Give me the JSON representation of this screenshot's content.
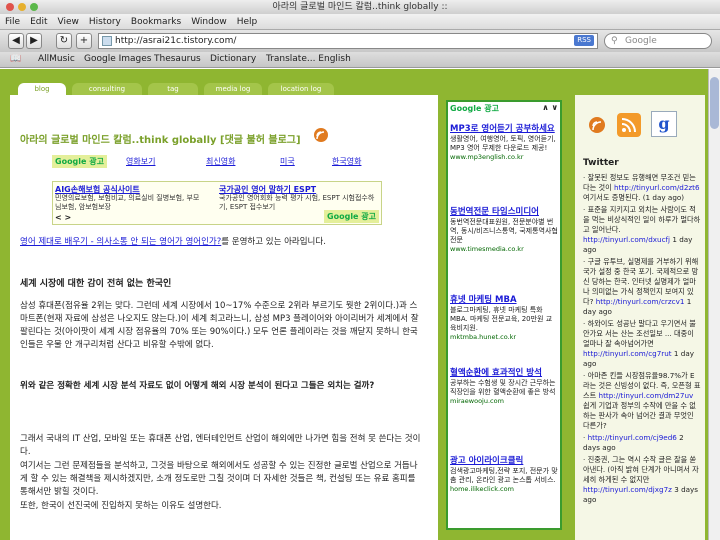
{
  "window": {
    "title": "아라의 글로벌 마인드 칼럼..think globally ::"
  },
  "menu": [
    "File",
    "Edit",
    "View",
    "History",
    "Bookmarks",
    "Window",
    "Help"
  ],
  "toolbar": {
    "url": "http://asrai21c.tistory.com/",
    "rss": "RSS",
    "search_placeholder": "Google"
  },
  "bookmarks": [
    "AllMusic",
    "Google Images",
    "Thesaurus",
    "Dictionary",
    "Translate... English"
  ],
  "tabs": [
    "blog",
    "consulting",
    "tag",
    "media log",
    "location log"
  ],
  "blog": {
    "title": "아라의 글로벌 마인드 칼럼..think globally [댓글 불허 블로그]"
  },
  "adlinks": {
    "brand": "Google 광고",
    "items": [
      "영화보기",
      "최신영화",
      "미국",
      "한국영화"
    ]
  },
  "ad_banner": {
    "left_title": "AIG손해보험 공식사이트",
    "left_desc": "민영의료보험, 보험비교, 의료실비 질병보험, 부모님보험, 암보험보장",
    "right_title": "국가공인 영어 말하기 ESPT",
    "right_desc": "국가공인 영어회화 능력 평가 시험, ESPT 시험접수하기, ESPT 접수보기",
    "nav": "< >",
    "brand": "Google 광고"
  },
  "post": {
    "intro_link": "영어 제대로 배우기 - 의사소통 안 되는 영어가 영어인가?",
    "intro_rest": "를 운영하고 있는 아라입니다.",
    "heading1": "세계 시장에 대한 감이 전혀 없는 한국인",
    "para1": "삼성 휴대폰(점유율 2위는 맞다. 그런데 세계 시장에서 10~17% 수준으로 2위라 부르기도 뭣한 2위이다.)과 스마트폰(현재 자료에 삼성은 나오지도 않는다.)이 세계 최고라느니, 삼성 MP3 플레이어와 아이리버가 세계에서 잘 팔린다는 것(아이팟이 세계 시장 점유율의 70% 또는 90%이다.) 모두 언론 플레이라는 것을 깨닫지 못하니 한국인들은 우물 안 개구리처럼 산다고 비유할 수밖에 없다.",
    "heading2": "위와 같은 정확한 세계 시장 분석 자료도 없이 어떻게 해외 시장 분석이 된다고 그들은 외치는 걸까?",
    "para2": "그래서 국내의 IT 산업, 모바일 또는 휴대폰 산업, 엔터테인먼트 산업이 해외에만 나가면 힘을 전혀 못 쓴다는 것이다.",
    "para3": "여기서는 그런 문제점들을 분석하고, 그것을 바탕으로 해외에서도 성공할 수 있는 진정한 글로벌 산업으로 거듭나게 할 수 있는 해결책을 제시하겠지만, 소개 정도로만 그칠 것이며 더 자세한 것들은 책, 컨설팅 또는 유료 홈피를 통해서만 밝힐 것이다.",
    "para4": "또한, 한국이 선진국에 진입하지 못하는 이유도 설명한다."
  },
  "ad_column": {
    "brand": "Google 광고",
    "nav": "∧ ∨",
    "ads": [
      {
        "title": "MP3로 영어듣기 공부하세요",
        "desc": "생활영어, 여행영어, 토픽, 영어듣기, MP3 영어 무제한 다운로드 제공!",
        "url": "www.mp3english.co.kr"
      },
      {
        "title": "동번역전문 타임스미디어",
        "desc": "동번역전문대표원원, 전문분야별 번역, 동시/비즈니스통역, 국제통역사협전문",
        "url": "www.timesmedia.co.kr"
      },
      {
        "title": "휴넷 마케팅 MBA",
        "desc": "블로그마케팅, 휴넷 마케팅 특화 MBA. 마케팅 전문교육, 20만원 교육비지원.",
        "url": "mktmba.hunet.co.kr"
      },
      {
        "title": "혈액순환에 효과적인 방석",
        "desc": "공부하는 수험생 및 장시간 근무하는 직장인을 위한 혈액순환에 좋은 방석",
        "url": "miraewooju.com"
      },
      {
        "title": "광고 아이라이크클릭",
        "desc": "검색광고마케팅,전략 포지, 전문가 맞춤 관리, 온라인 광고 논스톱 서비스.",
        "url": "home.ilikeclick.com"
      }
    ]
  },
  "sidebar": {
    "heading": "Twitter",
    "tweets": [
      {
        "text": "잘못된 정보도 유행해면 무조건 믿는다는 것이",
        "link": "http://tinyurl.com/d2zt6",
        "tail": "여기서도 증명된다. (1 day ago)"
      },
      {
        "text": "표준을 지키지고 외치는 사람이도 적을 먹는 비상식적인 일이 하루가 멀다하고 일어난다.",
        "link": "http://tinyurl.com/dxucfj",
        "tail": "1 day ago"
      },
      {
        "text": "구글 유투브, 실명제를 거부하기 위해 국가 설정 중 한국 포기. 국제적으로 망신 당하는 한국. 인터넷 실명제가 얼마나 의미없는 가식 정책인지 보여지 있다?",
        "link": "http://tinyurl.com/crzcv1",
        "tail": "1 day ago"
      },
      {
        "text": "하와이도 성공난 말다고 우기면서 불안가요 서는 산는 조선일보 ... 대중이 얼마나 잘 속아넘어가면",
        "link": "http://tinyurl.com/cg7rut",
        "tail": "1 day ago"
      },
      {
        "text": "아마존 킨들 시장점유율98.7%가 E라는 것은 신빙성이 없다. 즉, 오픈형 표스트",
        "link": "http://tinyurl.com/dm27uv",
        "tail": "쉽게 기업과 정부의 수작에 만을 수 없하는 판사가 속아 넘어간 결과 무엇인 다른가?"
      },
      {
        "text": "",
        "link": "http://tinyurl.com/cj9ed6",
        "tail": "2 days ago"
      },
      {
        "text": "진중권, 그는 역시 수작 글은 잘을 쏟아낸다. (아직 밝혀 단계가 아니며서 자세히 하게된 수 없지만",
        "link": "http://tinyurl.com/djxg7z",
        "tail": "3 days ago"
      }
    ]
  },
  "colors": {
    "frame": "#8fb631",
    "adborder": "#3a9b2e",
    "link": "#1a1ad6",
    "green": "#1b7a1b"
  }
}
